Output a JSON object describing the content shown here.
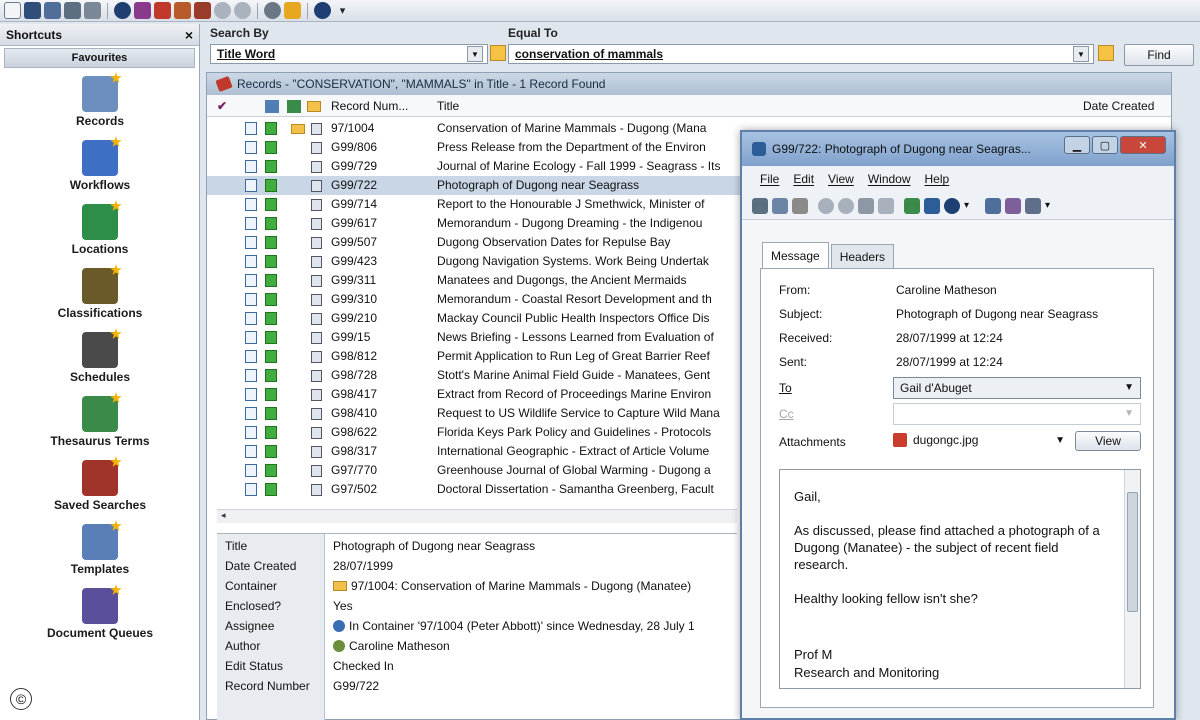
{
  "sidebar": {
    "title": "Shortcuts",
    "close": "×",
    "favourites": "Favourites",
    "items": [
      {
        "label": "Records",
        "color": "#6d8fbf"
      },
      {
        "label": "Workflows",
        "color": "#3f6fc4"
      },
      {
        "label": "Locations",
        "color": "#2f8d4a"
      },
      {
        "label": "Classifications",
        "color": "#6a5a2a"
      },
      {
        "label": "Schedules",
        "color": "#4a4a4a"
      },
      {
        "label": "Thesaurus Terms",
        "color": "#3a8a4a"
      },
      {
        "label": "Saved Searches",
        "color": "#a0332a"
      },
      {
        "label": "Templates",
        "color": "#5a7fb8"
      },
      {
        "label": "Document Queues",
        "color": "#5a4f9a"
      }
    ]
  },
  "search": {
    "search_by_label": "Search By",
    "search_by_value": "Title Word",
    "equal_to_label": "Equal To",
    "equal_to_value": "conservation of mammals",
    "find_label": "Find"
  },
  "records": {
    "title": "Records - \"CONSERVATION\", \"MAMMALS\" in Title - 1 Record Found",
    "columns": {
      "check": "✔",
      "number": "Record Num...",
      "title": "Title",
      "date": "Date Created"
    },
    "rows": [
      {
        "number": "97/1004",
        "title": "Conservation of Marine Mammals - Dugong (Mana"
      },
      {
        "number": "G99/806",
        "title": "Press Release from the Department of the Environ"
      },
      {
        "number": "G99/729",
        "title": "Journal of Marine Ecology - Fall 1999 - Seagrass - Its"
      },
      {
        "number": "G99/722",
        "title": "Photograph of Dugong near Seagrass"
      },
      {
        "number": "G99/714",
        "title": "Report to the Honourable J Smethwick, Minister of"
      },
      {
        "number": "G99/617",
        "title": "Memorandum - Dugong Dreaming - the Indigenou"
      },
      {
        "number": "G99/507",
        "title": "Dugong Observation Dates for Repulse Bay"
      },
      {
        "number": "G99/423",
        "title": "Dugong Navigation Systems. Work Being Undertak"
      },
      {
        "number": "G99/311",
        "title": "Manatees and Dugongs, the Ancient Mermaids"
      },
      {
        "number": "G99/310",
        "title": "Memorandum - Coastal Resort Development and th"
      },
      {
        "number": "G99/210",
        "title": "Mackay Council Public Health Inspectors Office Dis"
      },
      {
        "number": "G99/15",
        "title": "News Briefing - Lessons Learned from Evaluation of"
      },
      {
        "number": "G98/812",
        "title": "Permit Application to Run Leg of Great Barrier Reef"
      },
      {
        "number": "G98/728",
        "title": "Stott's Marine Animal Field Guide - Manatees, Gent"
      },
      {
        "number": "G98/417",
        "title": "Extract from Record of Proceedings Marine Environ"
      },
      {
        "number": "G98/410",
        "title": "Request to US Wildlife Service to Capture Wild Mana"
      },
      {
        "number": "G98/622",
        "title": "Florida Keys Park Policy and Guidelines - Protocols"
      },
      {
        "number": "G98/317",
        "title": "International Geographic - Extract of Article Volume"
      },
      {
        "number": "G97/770",
        "title": "Greenhouse Journal of Global Warming - Dugong a"
      },
      {
        "number": "G97/502",
        "title": "Doctoral Dissertation - Samantha Greenberg, Facult"
      }
    ]
  },
  "details": [
    {
      "key": "Title",
      "value": "Photograph of Dugong near Seagrass"
    },
    {
      "key": "Date Created",
      "value": "28/07/1999"
    },
    {
      "key": "Container",
      "value": "97/1004: Conservation of Marine Mammals - Dugong (Manatee)"
    },
    {
      "key": "Enclosed?",
      "value": "Yes"
    },
    {
      "key": "Assignee",
      "value": "In Container '97/1004 (Peter Abbott)' since Wednesday, 28 July 1"
    },
    {
      "key": "Author",
      "value": "Caroline Matheson"
    },
    {
      "key": "Edit Status",
      "value": "Checked In"
    },
    {
      "key": "Record Number",
      "value": "G99/722"
    }
  ],
  "message_window": {
    "title": "G99/722: Photograph of Dugong near Seagras...",
    "menu": [
      "File",
      "Edit",
      "View",
      "Window",
      "Help"
    ],
    "tabs": [
      "Message",
      "Headers"
    ],
    "from_label": "From:",
    "from_value": "Caroline Matheson",
    "subject_label": "Subject:",
    "subject_value": "Photograph of Dugong near Seagrass",
    "received_label": "Received:",
    "received_value": "28/07/1999 at 12:24",
    "sent_label": "Sent:",
    "sent_value": "28/07/1999 at 12:24",
    "to_label": "To",
    "to_value": "Gail d'Abuget",
    "cc_label": "Cc",
    "cc_value": "",
    "attachments_label": "Attachments",
    "attachment_value": "dugongc.jpg",
    "view_label": "View",
    "body": {
      "greeting": "Gail,",
      "para1": "As discussed, please find attached a photograph of a Dugong (Manatee) - the subject of recent field research.",
      "para2": "Healthy looking fellow isn't she?",
      "sign1": "Prof M",
      "sign2": "Research and Monitoring"
    }
  },
  "copyright": "©"
}
